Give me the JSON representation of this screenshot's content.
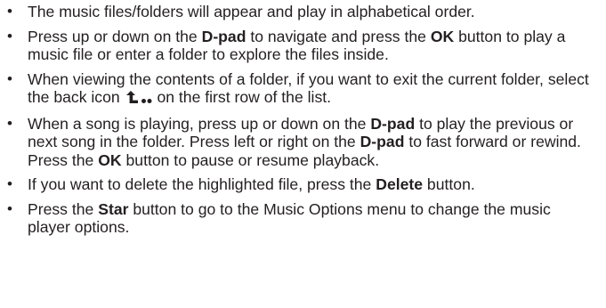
{
  "bullets": [
    {
      "text": "The music files/folders will appear and play in alphabetical order."
    },
    {
      "t1": "Press up or down on the ",
      "k1": "D-pad",
      "t2": " to navigate and press the ",
      "k2": "OK",
      "t3": " button to play a music file or enter a folder to explore the files inside."
    },
    {
      "t1": "When viewing the contents of a folder, if you want to exit the current folder, select the back icon ",
      "icon": "back-arrow-icon",
      "t2": " on the first row of the list."
    },
    {
      "t1": "When a song is playing, press up or down on the ",
      "k1": "D-pad",
      "t2": " to play the previous or next song in the folder. Press left or right on the ",
      "k2": "D-pad",
      "t3": " to fast forward or rewind. Press the ",
      "k3": "OK",
      "t4": " button to pause or resume playback."
    },
    {
      "t1": "If you want to delete the highlighted file, press the ",
      "k1": "Delete",
      "t2": " button."
    },
    {
      "t1": "Press the ",
      "k1": "Star",
      "t2": " button to go to the Music Options menu to change the music player options."
    }
  ]
}
